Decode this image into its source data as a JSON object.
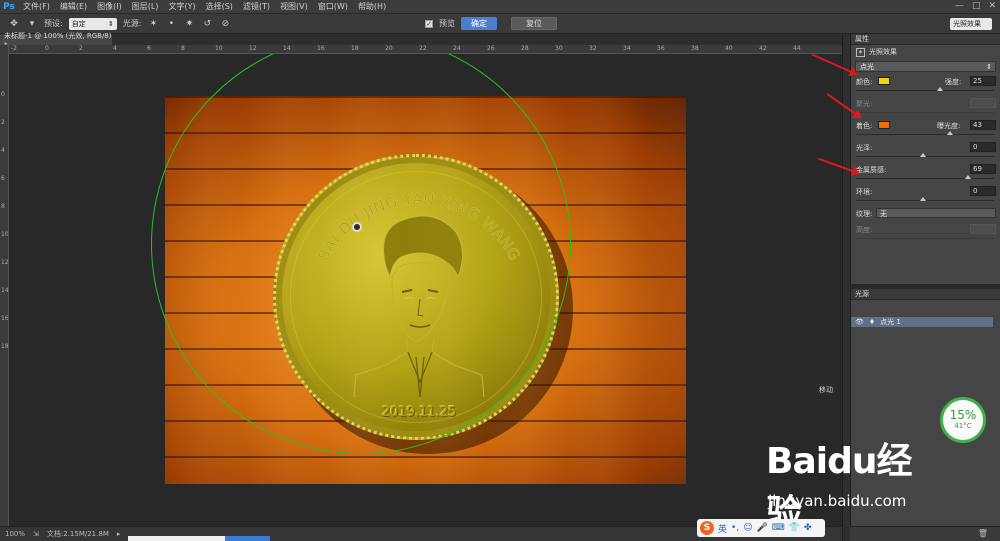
{
  "app": {
    "logo": "Ps",
    "menu": [
      "文件(F)",
      "编辑(E)",
      "图像(I)",
      "图层(L)",
      "文字(Y)",
      "选择(S)",
      "滤镜(T)",
      "视图(V)",
      "窗口(W)",
      "帮助(H)"
    ],
    "window_controls": [
      "—",
      "□",
      "✕"
    ]
  },
  "options_bar": {
    "preset_label": "预设:",
    "preset_value": "自定",
    "light_label": "光源:",
    "checkbox_label": "预览",
    "ok_label": "确定",
    "reset_label": "复位",
    "workspace_value": "光照效果"
  },
  "document": {
    "tab_title": "未标题-1 @ 100% (光效, RGB/8) *",
    "ruler_top_labels": [
      "-2",
      "0",
      "2",
      "4",
      "6",
      "8",
      "10",
      "12",
      "14",
      "16",
      "18",
      "20",
      "22",
      "24",
      "26",
      "28",
      "30",
      "32",
      "34",
      "36",
      "38",
      "40",
      "42",
      "44"
    ],
    "ruler_left_labels": [
      "0",
      "2",
      "4",
      "6",
      "8",
      "10",
      "12",
      "14",
      "16",
      "18"
    ],
    "coin_text": "BAI DU JING YAN XING WANG",
    "coin_date": "2019.11.25",
    "hud_label": "移动"
  },
  "status": {
    "zoom": "100%",
    "doc_info": "文档:2.15M/21.8M"
  },
  "properties": {
    "panel_title": "属性",
    "header": "光照效果",
    "light_type": "点光",
    "color_label": "颜色:",
    "color_hex": "#f2d600",
    "intensity_label": "强度:",
    "intensity_value": "25",
    "hotspot_label": "聚光:",
    "shade_label": "着色:",
    "shade_hex": "#f26a00",
    "exposure_label": "曝光度:",
    "exposure_value": "43",
    "gloss_label": "光泽:",
    "gloss_value": "0",
    "metallic_label": "金属质感:",
    "metallic_value": "69",
    "ambience_label": "环境:",
    "ambience_value": "0",
    "texture_label": "纹理:",
    "texture_value": "无",
    "height_label": "高度:"
  },
  "sliders": {
    "intensity": 0.63,
    "exposure": 0.71,
    "gloss": 0.5,
    "metallic": 0.84,
    "ambience": 0.5
  },
  "lights": {
    "panel_title": "光源",
    "item_label": "点光 1"
  },
  "cpu": {
    "percent": "15%",
    "temp": "41°C"
  },
  "watermark": {
    "logo": "Baidu经验",
    "url": "jingyan.baidu.com"
  },
  "ime": {
    "lang": "英"
  }
}
